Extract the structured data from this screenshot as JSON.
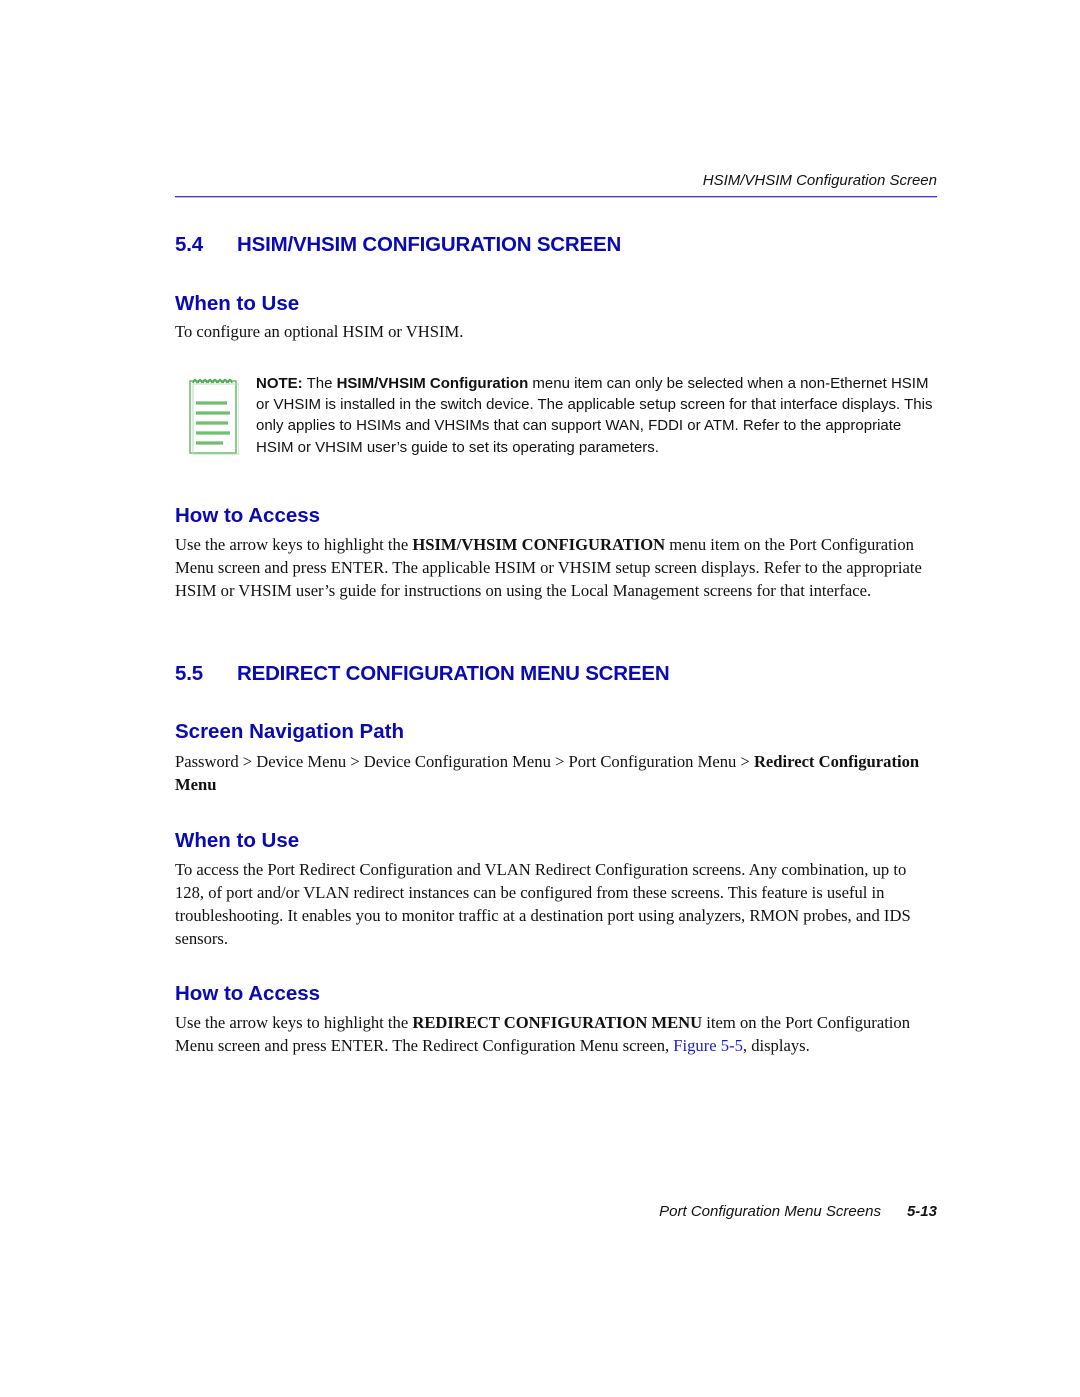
{
  "header": {
    "running_title": "HSIM/VHSIM Configuration Screen",
    "rule_color": "#3d3dc6"
  },
  "section_5_4": {
    "number": "5.4",
    "title": "HSIM/VHSIM CONFIGURATION SCREEN",
    "when_to_use": {
      "heading": "When to Use",
      "text": "To configure an optional HSIM or VHSIM."
    },
    "note": {
      "icon": "notepad-icon",
      "label": "NOTE:",
      "pre": " The ",
      "bold_term": "HSIM/VHSIM Configuration",
      "post": " menu item can only be selected when a non-Ethernet HSIM or VHSIM is installed in the switch device. The applicable setup screen for that interface displays. This only applies to HSIMs and VHSIMs that can support WAN, FDDI or ATM. Refer to the appropriate HSIM or VHSIM user’s guide to set its operating parameters."
    },
    "how_to_access": {
      "heading": "How to Access",
      "pre": "Use the arrow keys to highlight the ",
      "bold_term": "HSIM/VHSIM CONFIGURATION",
      "post": " menu item on the Port Configuration Menu screen and press ENTER. The applicable HSIM or VHSIM setup screen displays. Refer to the appropriate HSIM or VHSIM user’s guide for instructions on using the Local Management screens for that interface."
    }
  },
  "section_5_5": {
    "number": "5.5",
    "title": "REDIRECT CONFIGURATION MENU SCREEN",
    "navigation_path": {
      "heading": "Screen Navigation Path",
      "plain": "Password > Device Menu > Device Configuration Menu > Port Configuration Menu > ",
      "bold_end": "Redirect Configuration Menu"
    },
    "when_to_use": {
      "heading": "When to Use",
      "text": "To access the Port Redirect Configuration and VLAN Redirect Configuration screens. Any combination, up to 128, of port and/or VLAN redirect instances can be configured from these screens. This feature is useful in troubleshooting. It enables you to monitor traffic at a destination port using analyzers, RMON probes, and IDS sensors."
    },
    "how_to_access": {
      "heading": "How to Access",
      "pre": "Use the arrow keys to highlight the ",
      "bold_term": "REDIRECT CONFIGURATION MENU",
      "mid": " item on the Port Configuration Menu screen and press ENTER. The Redirect Configuration Menu screen, ",
      "link_text": "Figure 5-5",
      "post": ", displays."
    }
  },
  "footer": {
    "chapter_title": "Port Configuration Menu Screens",
    "page_number": "5-13"
  },
  "colors": {
    "heading_blue": "#0a0ab4",
    "link_blue": "#1a1ad0",
    "note_icon_green": "#6fbf6f"
  }
}
